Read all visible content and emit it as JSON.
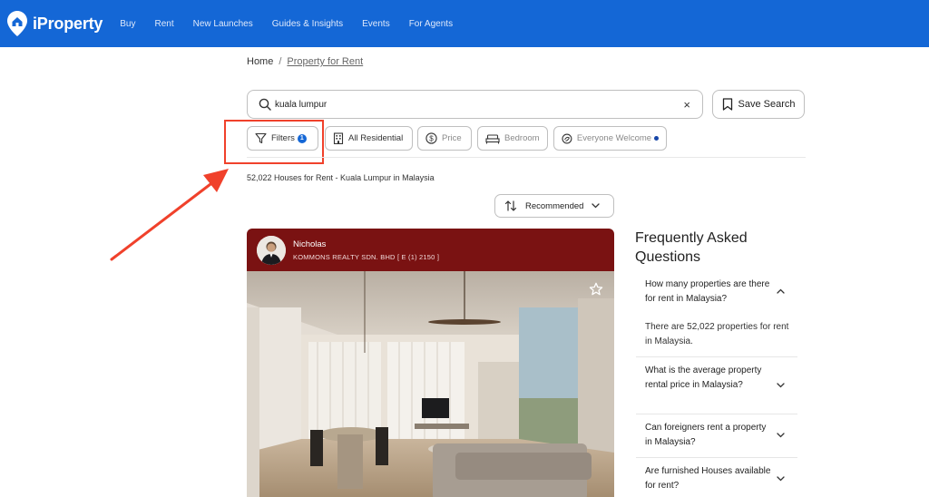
{
  "header": {
    "brand": "iProperty",
    "nav": [
      "Buy",
      "Rent",
      "New Launches",
      "Guides & Insights",
      "Events",
      "For Agents"
    ]
  },
  "breadcrumb": {
    "home": "Home",
    "separator": "/",
    "current": "Property for Rent"
  },
  "search": {
    "value": "kuala lumpur",
    "clear_icon": "×",
    "save_label": "Save Search"
  },
  "filters": {
    "filters_label": "Filters",
    "filters_count": "1",
    "residential_label": "All Residential",
    "price_label": "Price",
    "bedroom_label": "Bedroom",
    "everyone_label": "Everyone Welcome"
  },
  "results_text": "52,022 Houses for Rent - Kuala Lumpur in Malaysia",
  "sort": {
    "label": "Recommended"
  },
  "listing": {
    "agent_name": "Nicholas",
    "agent_company": "KOMMONS REALTY SDN. BHD [ E (1) 2150 ]"
  },
  "faq": {
    "title": "Frequently Asked Questions",
    "items": [
      {
        "question": "How many properties are there for rent in Malaysia?",
        "answer": "There are 52,022 properties for rent in Malaysia.",
        "expanded": true
      },
      {
        "question": "What is the average property rental price in Malaysia?",
        "expanded": false
      },
      {
        "question": "Can foreigners rent a property in Malaysia?",
        "expanded": false
      },
      {
        "question": "Are furnished Houses available for rent?",
        "expanded": false
      }
    ]
  },
  "colors": {
    "brand_blue": "#1467d6",
    "agent_bar": "#7a1212",
    "annotation_red": "#f0412b"
  }
}
